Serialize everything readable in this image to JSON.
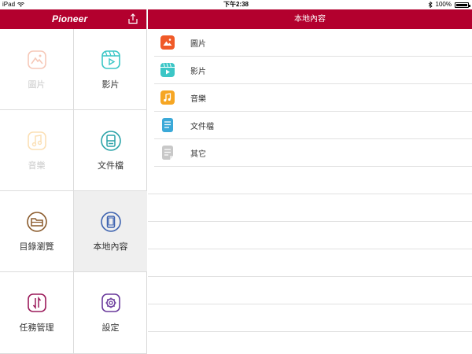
{
  "status_bar": {
    "device": "iPad",
    "time": "下午2:38",
    "battery": "100%"
  },
  "left_panel": {
    "brand": "Pioneer",
    "export_icon": "share-export-icon",
    "tiles": [
      {
        "label": "圖片",
        "icon": "photo-icon",
        "state": "disabled"
      },
      {
        "label": "影片",
        "icon": "video-icon",
        "state": "normal"
      },
      {
        "label": "音樂",
        "icon": "music-icon",
        "state": "disabled"
      },
      {
        "label": "文件檔",
        "icon": "document-icon",
        "state": "normal"
      },
      {
        "label": "目錄瀏覽",
        "icon": "folder-browse-icon",
        "state": "normal"
      },
      {
        "label": "本地內容",
        "icon": "local-device-icon",
        "state": "selected"
      },
      {
        "label": "任務管理",
        "icon": "task-transfer-icon",
        "state": "normal"
      },
      {
        "label": "設定",
        "icon": "gear-icon",
        "state": "normal"
      }
    ]
  },
  "right_panel": {
    "title": "本地內容",
    "items": [
      {
        "label": "圖片",
        "icon": "photo-icon",
        "color": "#f05a28"
      },
      {
        "label": "影片",
        "icon": "video-icon",
        "color": "#3cc6c6"
      },
      {
        "label": "音樂",
        "icon": "music-icon",
        "color": "#f6a623"
      },
      {
        "label": "文件檔",
        "icon": "document-icon",
        "color": "#3ba9d8"
      },
      {
        "label": "其它",
        "icon": "other-file-icon",
        "color": "#c8c8c8"
      }
    ]
  },
  "colors": {
    "brand_red": "#b3002e",
    "video_teal": "#3cc6c6",
    "document_teal": "#2aa3a8",
    "folder_brown": "#8a5a2b",
    "local_blue": "#3d63b0",
    "task_magenta": "#9c1b5b",
    "settings_purple": "#6a3a9c"
  }
}
